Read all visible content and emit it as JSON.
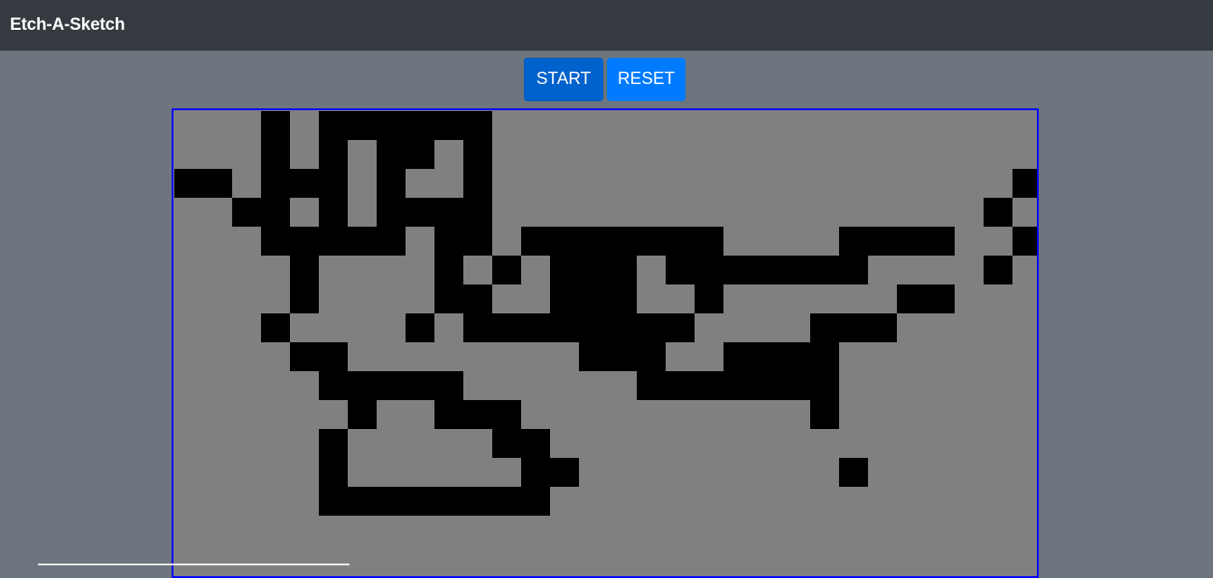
{
  "app": {
    "title": "Etch-A-Sketch"
  },
  "controls": {
    "start_label": "START",
    "reset_label": "RESET"
  },
  "colors": {
    "navbar": "#343a40",
    "page_background": "#6c757d",
    "board_border": "#0000ff",
    "cell_empty": "#808080",
    "cell_drawn": "#000000",
    "start_button": "#0062cc",
    "reset_button": "#007bff"
  },
  "board": {
    "columns": 30,
    "visible_rows": 16,
    "drawn_cells": [
      [
        0,
        3
      ],
      [
        0,
        5
      ],
      [
        0,
        6
      ],
      [
        0,
        7
      ],
      [
        0,
        8
      ],
      [
        0,
        9
      ],
      [
        0,
        10
      ],
      [
        1,
        3
      ],
      [
        1,
        5
      ],
      [
        1,
        7
      ],
      [
        1,
        8
      ],
      [
        1,
        10
      ],
      [
        2,
        0
      ],
      [
        2,
        1
      ],
      [
        2,
        3
      ],
      [
        2,
        4
      ],
      [
        2,
        5
      ],
      [
        2,
        7
      ],
      [
        2,
        10
      ],
      [
        2,
        29
      ],
      [
        3,
        2
      ],
      [
        3,
        3
      ],
      [
        3,
        5
      ],
      [
        3,
        7
      ],
      [
        3,
        8
      ],
      [
        3,
        9
      ],
      [
        3,
        10
      ],
      [
        3,
        28
      ],
      [
        4,
        3
      ],
      [
        4,
        4
      ],
      [
        4,
        5
      ],
      [
        4,
        6
      ],
      [
        4,
        7
      ],
      [
        4,
        9
      ],
      [
        4,
        10
      ],
      [
        4,
        12
      ],
      [
        4,
        13
      ],
      [
        4,
        14
      ],
      [
        4,
        15
      ],
      [
        4,
        16
      ],
      [
        4,
        17
      ],
      [
        4,
        18
      ],
      [
        4,
        23
      ],
      [
        4,
        24
      ],
      [
        4,
        25
      ],
      [
        4,
        26
      ],
      [
        4,
        29
      ],
      [
        5,
        4
      ],
      [
        5,
        9
      ],
      [
        5,
        11
      ],
      [
        5,
        13
      ],
      [
        5,
        14
      ],
      [
        5,
        15
      ],
      [
        5,
        17
      ],
      [
        5,
        18
      ],
      [
        5,
        19
      ],
      [
        5,
        20
      ],
      [
        5,
        21
      ],
      [
        5,
        22
      ],
      [
        5,
        23
      ],
      [
        5,
        28
      ],
      [
        6,
        4
      ],
      [
        6,
        9
      ],
      [
        6,
        10
      ],
      [
        6,
        13
      ],
      [
        6,
        14
      ],
      [
        6,
        15
      ],
      [
        6,
        18
      ],
      [
        6,
        25
      ],
      [
        6,
        26
      ],
      [
        7,
        3
      ],
      [
        7,
        8
      ],
      [
        7,
        10
      ],
      [
        7,
        11
      ],
      [
        7,
        12
      ],
      [
        7,
        13
      ],
      [
        7,
        14
      ],
      [
        7,
        15
      ],
      [
        7,
        16
      ],
      [
        7,
        17
      ],
      [
        7,
        22
      ],
      [
        7,
        23
      ],
      [
        7,
        24
      ],
      [
        8,
        4
      ],
      [
        8,
        5
      ],
      [
        8,
        14
      ],
      [
        8,
        15
      ],
      [
        8,
        16
      ],
      [
        8,
        19
      ],
      [
        8,
        20
      ],
      [
        8,
        21
      ],
      [
        8,
        22
      ],
      [
        9,
        5
      ],
      [
        9,
        6
      ],
      [
        9,
        7
      ],
      [
        9,
        8
      ],
      [
        9,
        9
      ],
      [
        9,
        16
      ],
      [
        9,
        17
      ],
      [
        9,
        18
      ],
      [
        9,
        19
      ],
      [
        9,
        20
      ],
      [
        9,
        21
      ],
      [
        9,
        22
      ],
      [
        10,
        6
      ],
      [
        10,
        9
      ],
      [
        10,
        10
      ],
      [
        10,
        11
      ],
      [
        10,
        22
      ],
      [
        11,
        5
      ],
      [
        11,
        11
      ],
      [
        11,
        12
      ],
      [
        12,
        5
      ],
      [
        12,
        12
      ],
      [
        12,
        13
      ],
      [
        12,
        23
      ],
      [
        13,
        5
      ],
      [
        13,
        6
      ],
      [
        13,
        7
      ],
      [
        13,
        8
      ],
      [
        13,
        9
      ],
      [
        13,
        10
      ],
      [
        13,
        11
      ],
      [
        13,
        12
      ]
    ]
  }
}
